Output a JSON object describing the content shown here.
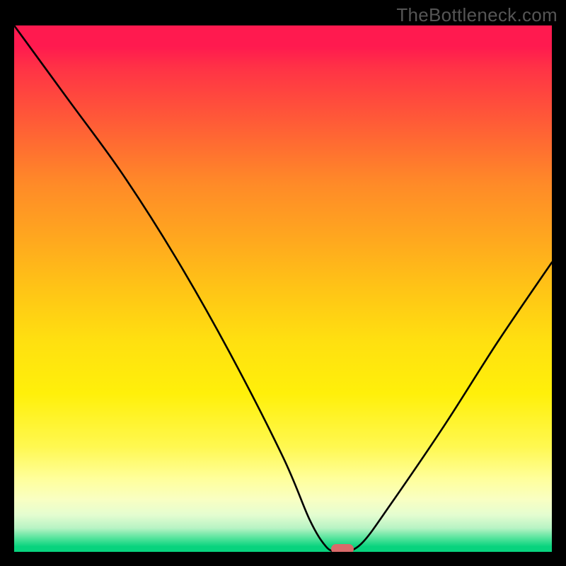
{
  "watermark": "TheBottleneck.com",
  "chart_data": {
    "type": "line",
    "title": "",
    "xlabel": "",
    "ylabel": "",
    "xlim": [
      0,
      100
    ],
    "ylim": [
      0,
      100
    ],
    "series": [
      {
        "name": "bottleneck-curve",
        "x": [
          0,
          10,
          20,
          30,
          40,
          50,
          55,
          58,
          60,
          62,
          65,
          70,
          80,
          90,
          100
        ],
        "values": [
          100,
          86,
          72,
          56,
          38,
          18,
          6,
          1,
          0,
          0,
          2,
          9,
          24,
          40,
          55
        ]
      }
    ],
    "marker": {
      "x": 61,
      "y": 0.5
    },
    "legend": false,
    "grid": false
  },
  "colors": {
    "curve": "#000000",
    "marker": "#d96a6a",
    "background_top": "#ff1a4f",
    "background_bottom": "#08d37e"
  }
}
